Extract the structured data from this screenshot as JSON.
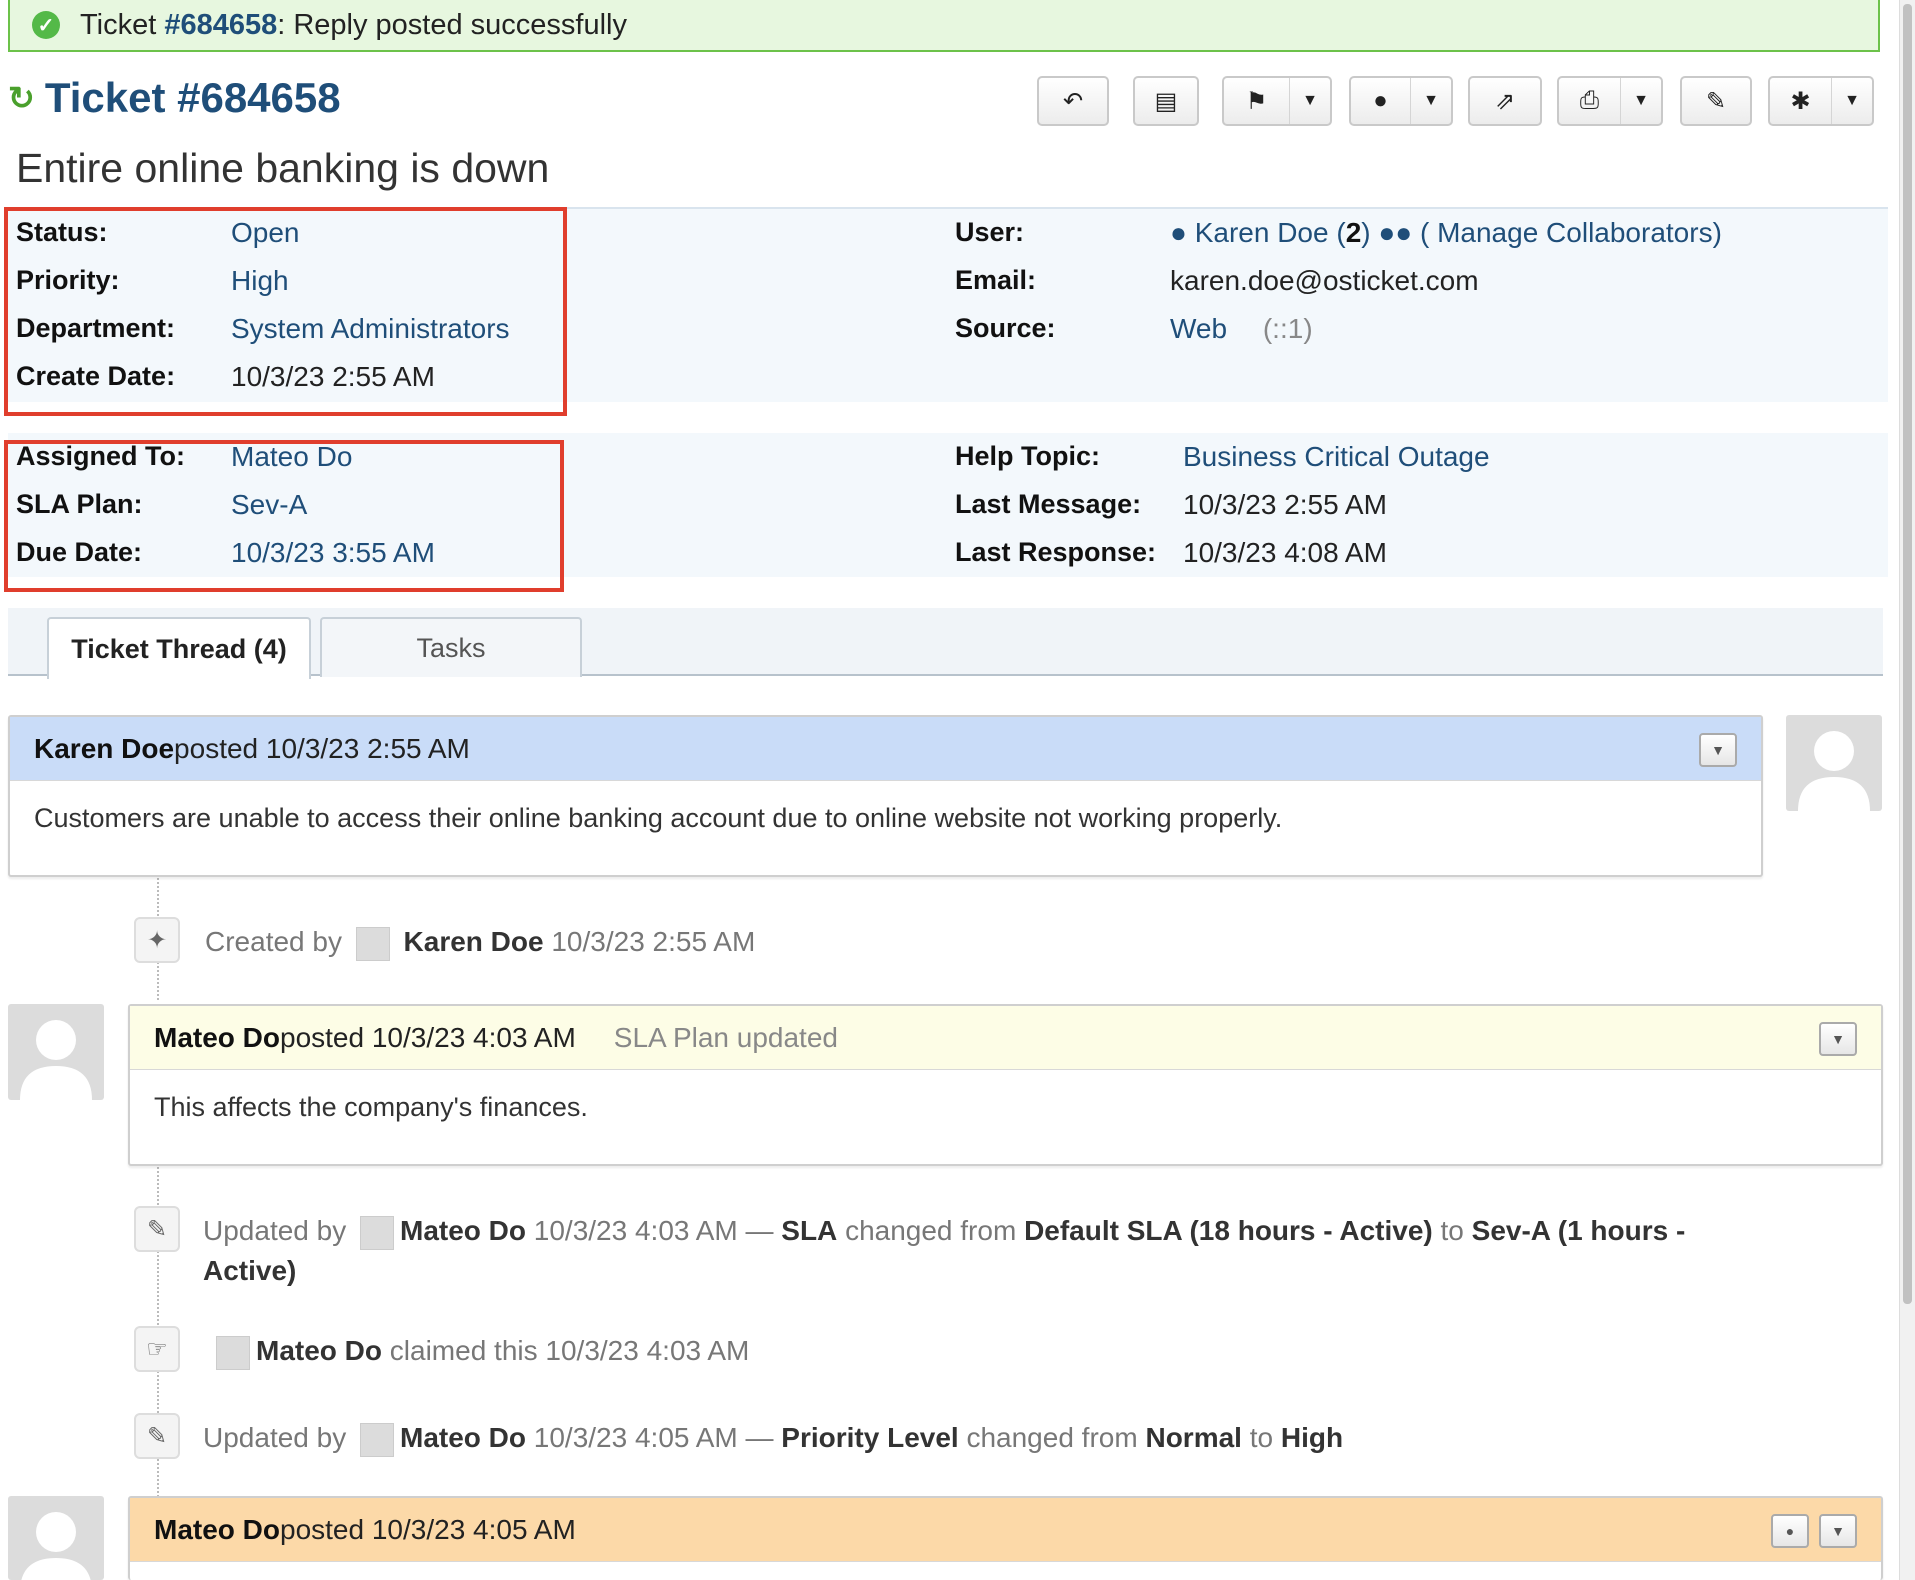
{
  "notice": {
    "prefix": "Ticket ",
    "number": "#684658",
    "suffix": ": Reply posted successfully"
  },
  "header": {
    "title": "Ticket #684658",
    "subject": "Entire online banking is down"
  },
  "toolbar": {
    "icons": [
      "reply-icon",
      "file-icon",
      "flag-icon",
      "user-icon",
      "share-icon",
      "print-icon",
      "edit-icon",
      "gear-icon"
    ]
  },
  "info_left": [
    {
      "label": "Status:",
      "value": "Open"
    },
    {
      "label": "Priority:",
      "value": "High"
    },
    {
      "label": "Department:",
      "value": "System Administrators"
    },
    {
      "label": "Create Date:",
      "value": "10/3/23 2:55 AM"
    }
  ],
  "info_right": {
    "user_label": "User:",
    "user_name": "Karen Doe",
    "user_count": "2",
    "manage_collab": "( Manage Collaborators)",
    "email_label": "Email:",
    "email": "karen.doe@osticket.com",
    "source_label": "Source:",
    "source": "Web",
    "source_ip": "(::1)"
  },
  "assign_left": [
    {
      "label": "Assigned To:",
      "value": "Mateo Do"
    },
    {
      "label": "SLA Plan:",
      "value": "Sev-A"
    },
    {
      "label": "Due Date:",
      "value": "10/3/23 3:55 AM"
    }
  ],
  "assign_right": [
    {
      "label": "Help Topic:",
      "value": "Business Critical Outage"
    },
    {
      "label": "Last Message:",
      "value": "10/3/23 2:55 AM"
    },
    {
      "label": "Last Response:",
      "value": "10/3/23 4:08 AM"
    }
  ],
  "tabs": [
    {
      "label": "Ticket Thread (4)"
    },
    {
      "label": "Tasks"
    }
  ],
  "thread": {
    "entry1": {
      "author": "Karen Doe",
      "posted": " posted 10/3/23 2:55 AM",
      "body": "Customers are unable to access their online banking account due to online website not working properly."
    },
    "event1": {
      "prefix": "Created by",
      "user": "Karen Doe",
      "time": "10/3/23 2:55 AM"
    },
    "entry2": {
      "author": "Mateo Do",
      "posted": " posted 10/3/23 4:03 AM",
      "note": "SLA Plan updated",
      "body": "This affects the company's finances."
    },
    "event2": {
      "prefix": "Updated by",
      "user": "Mateo Do",
      "time": "10/3/23 4:03 AM —",
      "field": "SLA",
      "changed": "changed from",
      "from": "Default SLA (18 hours - Active)",
      "to_word": "to",
      "to": "Sev-A (1 hours - Active)"
    },
    "event3": {
      "user": "Mateo Do",
      "text": "claimed this 10/3/23 4:03 AM"
    },
    "event4": {
      "prefix": "Updated by",
      "user": "Mateo Do",
      "time": "10/3/23 4:05 AM —",
      "field": "Priority Level",
      "changed": "changed from",
      "from": "Normal",
      "to_word": "to",
      "to": "High"
    },
    "entry3": {
      "author": "Mateo Do",
      "posted": " posted 10/3/23 4:05 AM"
    }
  },
  "colors": {
    "accent": "#1f4e79",
    "success": "#54b948",
    "highlight": "#e03e2d",
    "message": "#c9dcf8",
    "note": "#fdfde6",
    "response": "#fcd9a8"
  }
}
